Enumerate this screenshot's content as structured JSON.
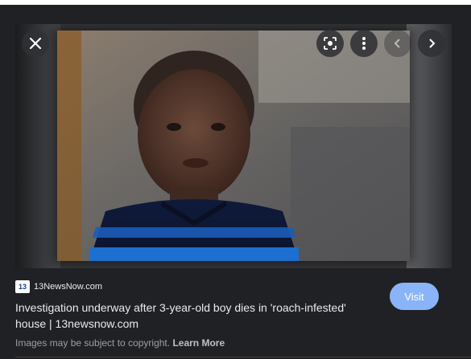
{
  "viewer": {
    "close_icon": "close-icon",
    "lens_icon": "lens-icon",
    "more_icon": "more-vert-icon",
    "prev_icon": "chevron-left-icon",
    "next_icon": "chevron-right-icon"
  },
  "result": {
    "favicon_text": "13",
    "source": "13NewsNow.com",
    "title": "Investigation underway after 3-year-old boy dies in 'roach-infested' house | 13newsnow.com",
    "visit_label": "Visit",
    "copyright_text": "Images may be subject to copyright.",
    "learn_more_label": "Learn More"
  },
  "colors": {
    "background": "#202124",
    "accent_button": "#8ab4f8",
    "text_primary": "#e8eaed",
    "text_secondary": "#9aa0a6"
  }
}
